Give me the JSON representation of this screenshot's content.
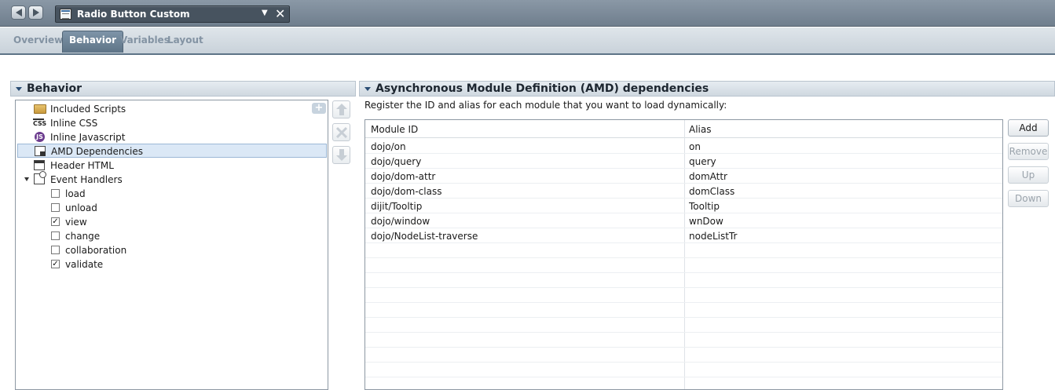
{
  "editor": {
    "title": "Radio Button Custom"
  },
  "page_tabs": [
    {
      "label": "Overview",
      "active": false
    },
    {
      "label": "Behavior",
      "active": true
    },
    {
      "label": "Variables",
      "active": false
    },
    {
      "label": "Layout",
      "active": false
    }
  ],
  "behavior_section": {
    "title": "Behavior",
    "tree": [
      {
        "label": "Included Scripts",
        "icon": "folder-icon"
      },
      {
        "label": "Inline CSS",
        "icon": "css-icon"
      },
      {
        "label": "Inline Javascript",
        "icon": "javascript-icon"
      },
      {
        "label": "AMD Dependencies",
        "icon": "amd-icon",
        "selected": true
      },
      {
        "label": "Header HTML",
        "icon": "header-html-icon"
      },
      {
        "label": "Event Handlers",
        "icon": "event-handlers-icon",
        "expanded": true
      },
      {
        "label": "load",
        "checked": false
      },
      {
        "label": "unload",
        "checked": false
      },
      {
        "label": "view",
        "checked": true
      },
      {
        "label": "change",
        "checked": false
      },
      {
        "label": "collaboration",
        "checked": false
      },
      {
        "label": "validate",
        "checked": true
      }
    ]
  },
  "amd_section": {
    "title": "Asynchronous Module Definition (AMD) dependencies",
    "description": "Register the ID and alias for each module that you want to load dynamically:",
    "columns": [
      "Module ID",
      "Alias"
    ],
    "rows": [
      [
        "dojo/on",
        "on"
      ],
      [
        "dojo/query",
        "query"
      ],
      [
        "dojo/dom-attr",
        "domAttr"
      ],
      [
        "dojo/dom-class",
        "domClass"
      ],
      [
        "dijit/Tooltip",
        "Tooltip"
      ],
      [
        "dojo/window",
        "wnDow"
      ],
      [
        "dojo/NodeList-traverse",
        "nodeListTr"
      ]
    ],
    "buttons": {
      "add": "Add",
      "remove": "Remove",
      "up": "Up",
      "down": "Down"
    }
  }
}
